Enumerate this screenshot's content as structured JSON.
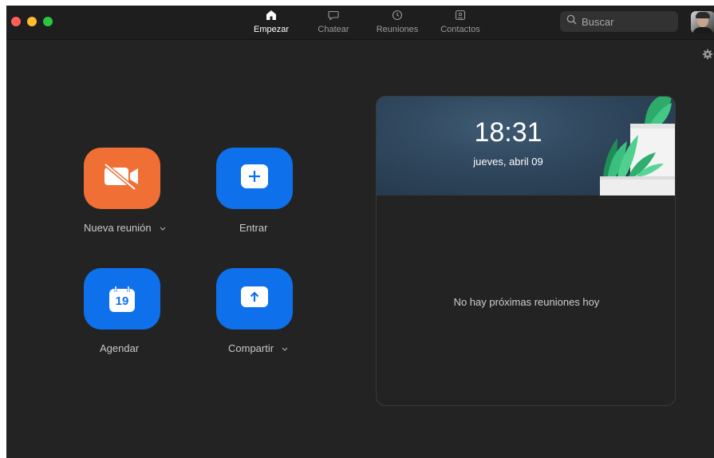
{
  "nav": {
    "tabs": [
      {
        "label": "Empezar",
        "icon": "home-icon",
        "active": true
      },
      {
        "label": "Chatear",
        "icon": "chat-bubble-icon",
        "active": false
      },
      {
        "label": "Reuniones",
        "icon": "clock-icon",
        "active": false
      },
      {
        "label": "Contactos",
        "icon": "contact-card-icon",
        "active": false
      }
    ]
  },
  "search": {
    "placeholder": "Buscar"
  },
  "actions": {
    "new_meeting": {
      "label": "Nueva reunión",
      "icon": "video-off-icon",
      "color": "#f06f35"
    },
    "join": {
      "label": "Entrar",
      "icon": "plus-icon",
      "color": "#0e71eb"
    },
    "schedule": {
      "label": "Agendar",
      "icon": "calendar-icon",
      "day": "19",
      "color": "#0e71eb"
    },
    "share": {
      "label": "Compartir",
      "icon": "share-up-arrow-icon",
      "color": "#0e71eb"
    }
  },
  "meetings_panel": {
    "time": "18:31",
    "date": "jueves, abril 09",
    "empty_message": "No hay próximas reuniones hoy"
  },
  "colors": {
    "window_bg": "#232323",
    "titlebar_bg": "#1e1e1e",
    "accent_blue": "#0e71eb",
    "accent_orange": "#f06f35"
  }
}
